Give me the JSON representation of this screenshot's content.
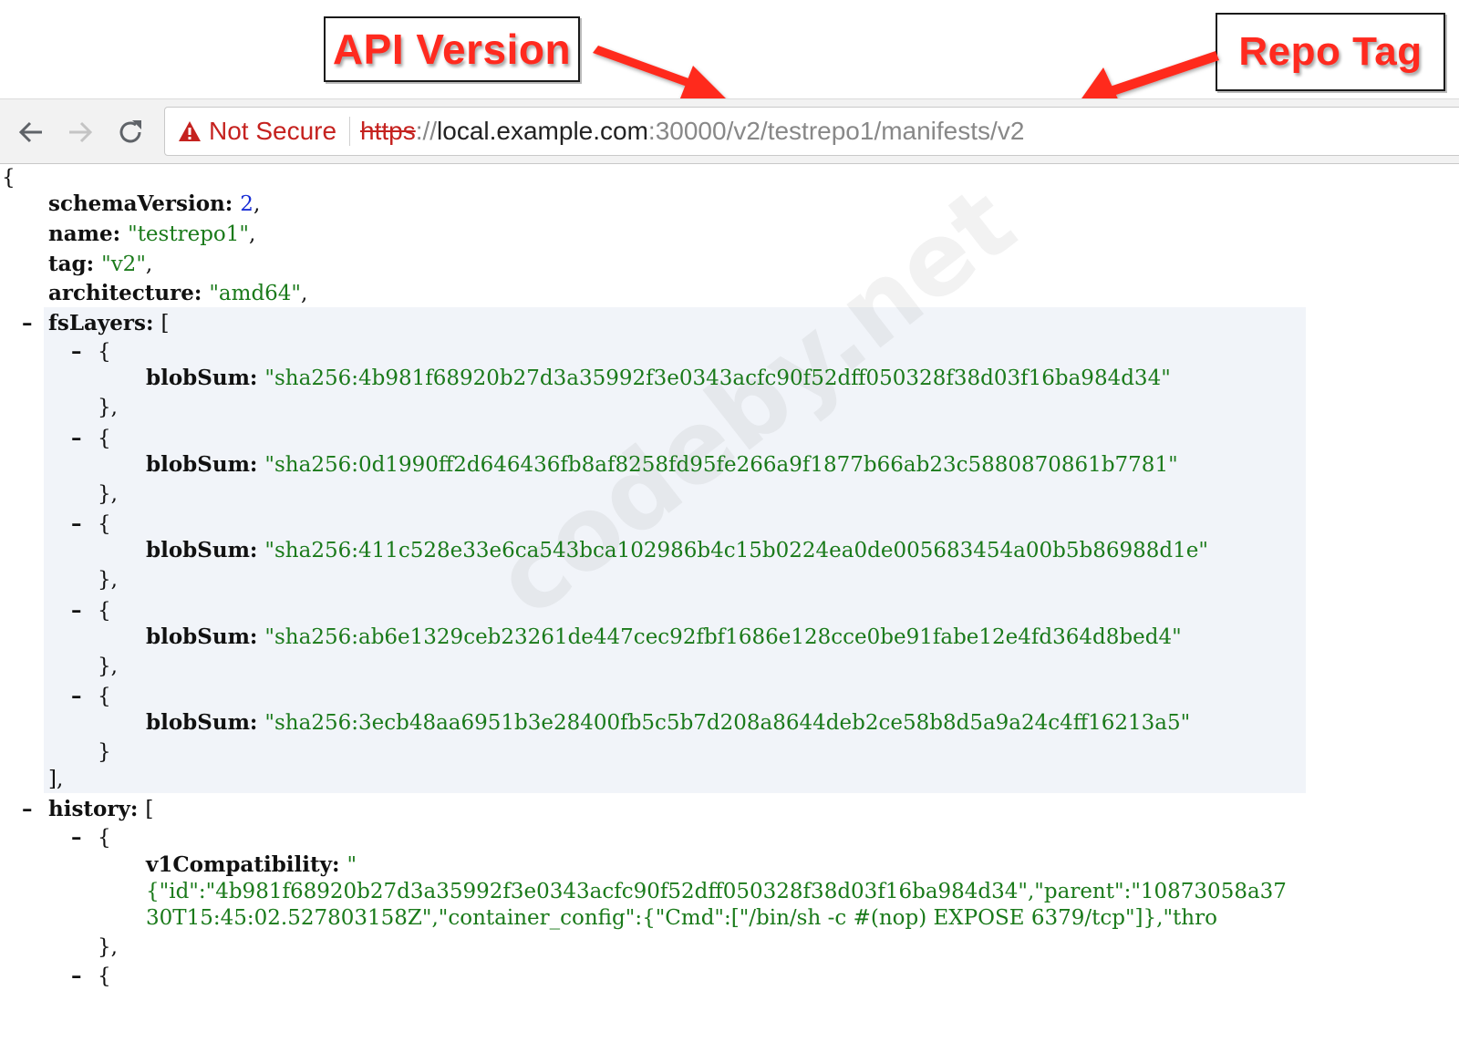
{
  "annotations": {
    "api_version": "API Version",
    "repo_tag": "Repo Tag",
    "arrow_color": "#ff2a1f"
  },
  "browser": {
    "security_label": "Not Secure",
    "url_scheme": "https",
    "url_sep": "://",
    "url_host": "local.example.com",
    "url_path": ":30000/v2/testrepo1/manifests/v2",
    "icons": [
      "back-arrow-icon",
      "forward-arrow-icon",
      "reload-icon",
      "warning-triangle-icon"
    ]
  },
  "json": {
    "open_brace": "{",
    "schemaVersion_key": "schemaVersion",
    "schemaVersion_val": "2",
    "name_key": "name",
    "name_val": "\"testrepo1\"",
    "tag_key": "tag",
    "tag_val": "\"v2\"",
    "architecture_key": "architecture",
    "architecture_val": "\"amd64\"",
    "fsLayers_key": "fsLayers",
    "blob_key": "blobSum",
    "blobs": [
      "\"sha256:4b981f68920b27d3a35992f3e0343acfc90f52dff050328f38d03f16ba984d34\"",
      "\"sha256:0d1990ff2d646436fb8af8258fd95fe266a9f1877b66ab23c5880870861b7781\"",
      "\"sha256:411c528e33e6ca543bca102986b4c15b0224ea0de005683454a00b5b86988d1e\"",
      "\"sha256:ab6e1329ceb23261de447cec92fbf1686e128cce0be91fabe12e4fd364d8bed4\"",
      "\"sha256:3ecb48aa6951b3e28400fb5c5b7d208a8644deb2ce58b8d5a9a24c4ff16213a5\""
    ],
    "history_key": "history",
    "v1_key": "v1Compatibility",
    "v1_open": "\"",
    "v1_line1": "{\"id\":\"4b981f68920b27d3a35992f3e0343acfc90f52dff050328f38d03f16ba984d34\",\"parent\":\"10873058a37",
    "v1_line2": "30T15:45:02.527803158Z\",\"container_config\":{\"Cmd\":[\"/bin/sh -c #(nop) EXPOSE 6379/tcp\"]},\"thro"
  },
  "watermark": "codeby.net"
}
